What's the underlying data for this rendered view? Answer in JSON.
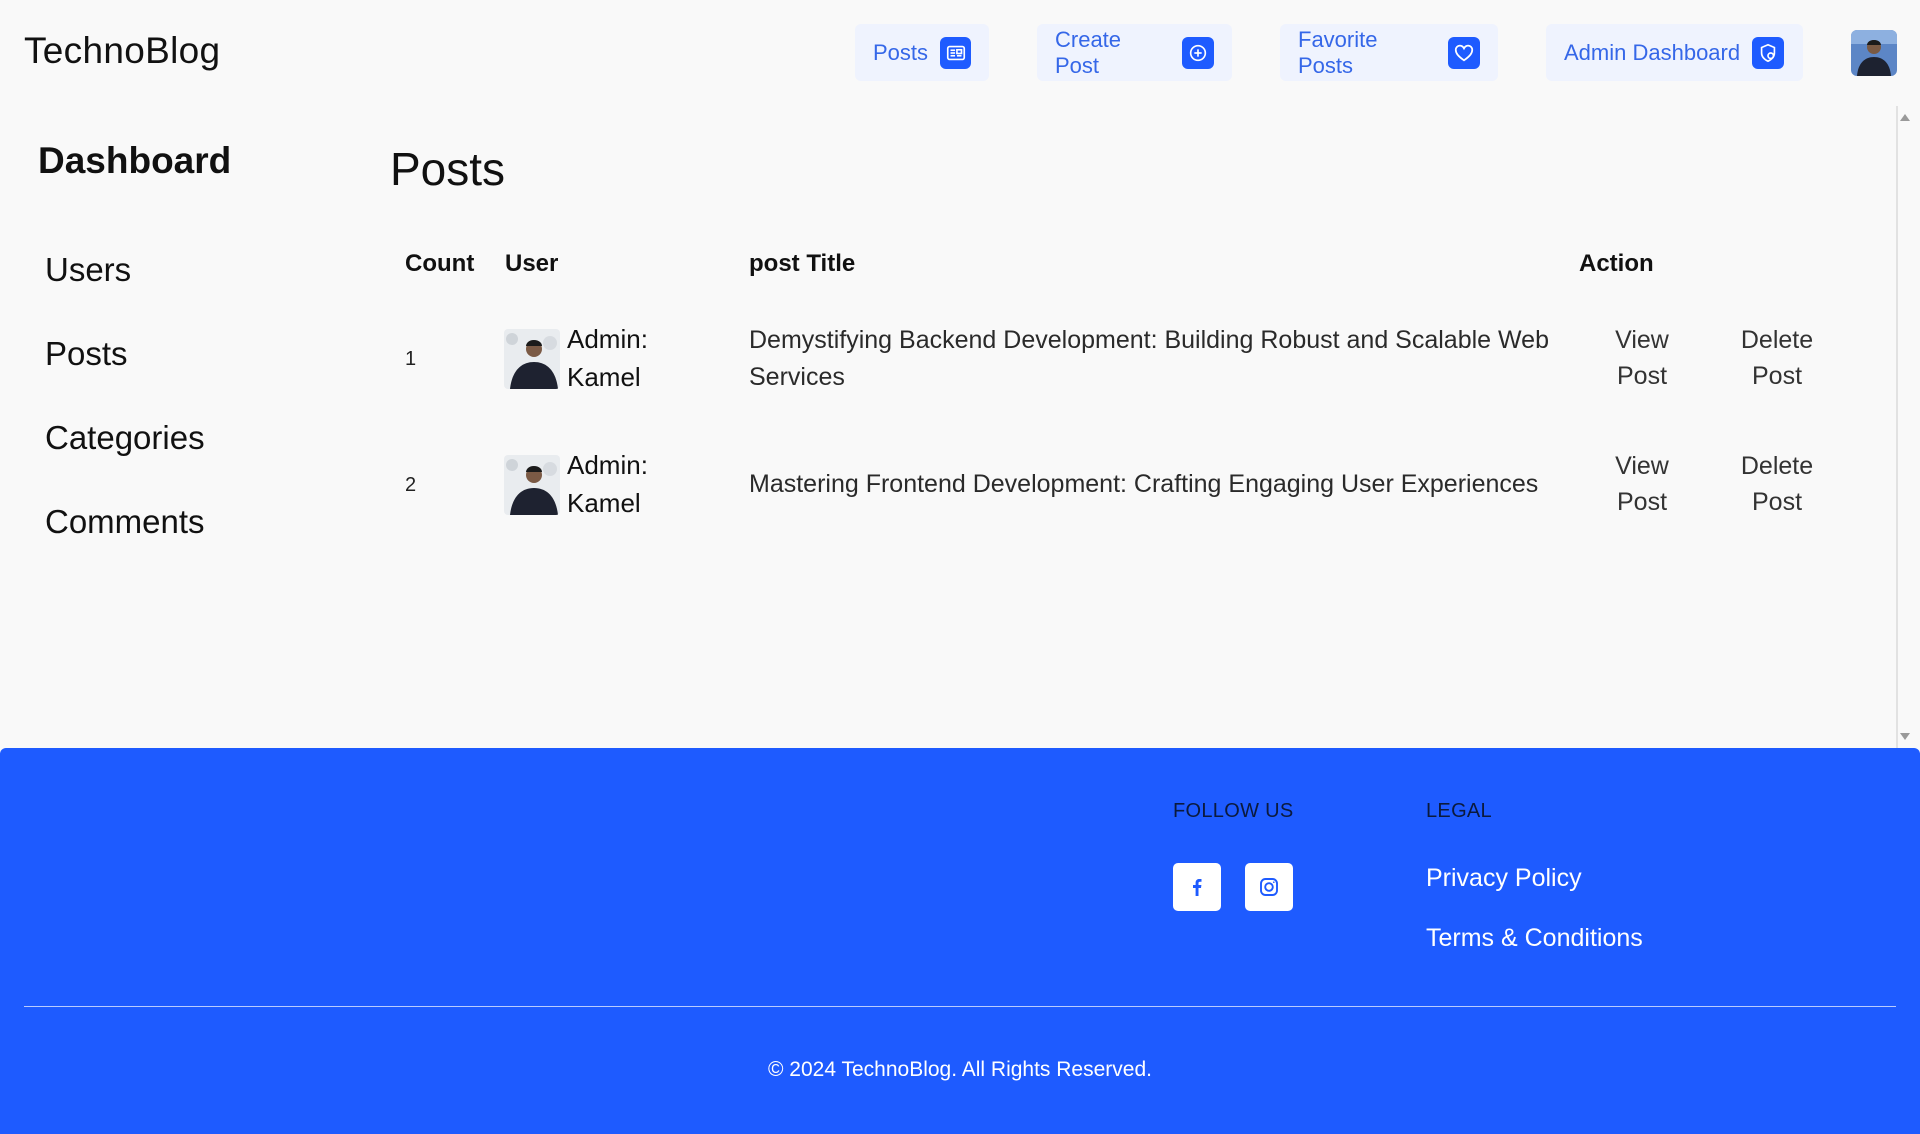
{
  "brand": "TechnoBlog",
  "nav": [
    {
      "label": "Posts",
      "icon": "newspaper-icon"
    },
    {
      "label": "Create Post",
      "icon": "plus-circle-icon"
    },
    {
      "label": "Favorite Posts",
      "icon": "heart-icon"
    },
    {
      "label": "Admin Dashboard",
      "icon": "admin-gear-icon"
    }
  ],
  "sidebar": {
    "title": "Dashboard",
    "items": [
      "Users",
      "Posts",
      "Categories",
      "Comments"
    ]
  },
  "main": {
    "title": "Posts",
    "columns": [
      "Count",
      "User",
      "post Title",
      "Action"
    ],
    "rows": [
      {
        "count": "1",
        "user_line1": "Admin:",
        "user_line2": "Kamel",
        "title": "Demystifying Backend Development: Building Robust and Scalable Web Services",
        "view_line1": "View",
        "view_line2": "Post",
        "delete_line1": "Delete",
        "delete_line2": "Post"
      },
      {
        "count": "2",
        "user_line1": "Admin:",
        "user_line2": "Kamel",
        "title": "Mastering Frontend Development: Crafting Engaging User Experiences",
        "view_line1": "View",
        "view_line2": "Post",
        "delete_line1": "Delete",
        "delete_line2": "Post"
      }
    ]
  },
  "footer": {
    "follow_heading": "FOLLOW US",
    "legal_heading": "LEGAL",
    "social": [
      "facebook-icon",
      "instagram-icon"
    ],
    "links": [
      "Privacy Policy",
      "Terms & Conditions"
    ],
    "copyright": "© 2024 TechnoBlog. All Rights Reserved."
  },
  "colors": {
    "accent": "#1e5bff",
    "nav_bg": "#eff3fe",
    "nav_text": "#3567e8",
    "page_bg": "#f9f9f9"
  }
}
